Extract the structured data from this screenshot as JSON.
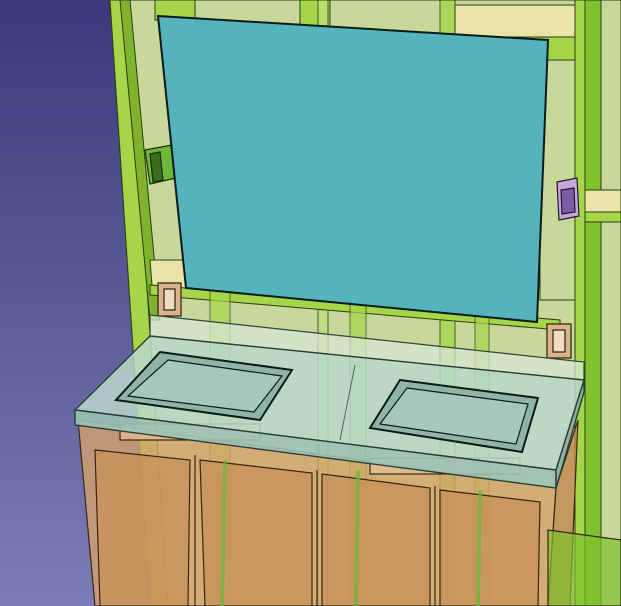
{
  "viewport": {
    "label": "",
    "background_top": "#3a3a7a",
    "background_bottom": "#7c7cb8"
  },
  "scene": {
    "objects": [
      {
        "name": "wall-frame",
        "color": "#9fce45"
      },
      {
        "name": "mirror",
        "color": "#55b3bb"
      },
      {
        "name": "vanity-countertop",
        "color": "#b8d8cc"
      },
      {
        "name": "sink-basin-left",
        "color": "#8fb5a8"
      },
      {
        "name": "sink-basin-right",
        "color": "#8fb5a8"
      },
      {
        "name": "vanity-cabinet",
        "color": "#d4a26c"
      },
      {
        "name": "electrical-outlet-left",
        "color": "#d9b48a"
      },
      {
        "name": "electrical-outlet-right",
        "color": "#d9b48a"
      },
      {
        "name": "switch-box-left",
        "color": "#6cb83a"
      },
      {
        "name": "switch-box-right",
        "color": "#7a5ba8"
      }
    ]
  }
}
